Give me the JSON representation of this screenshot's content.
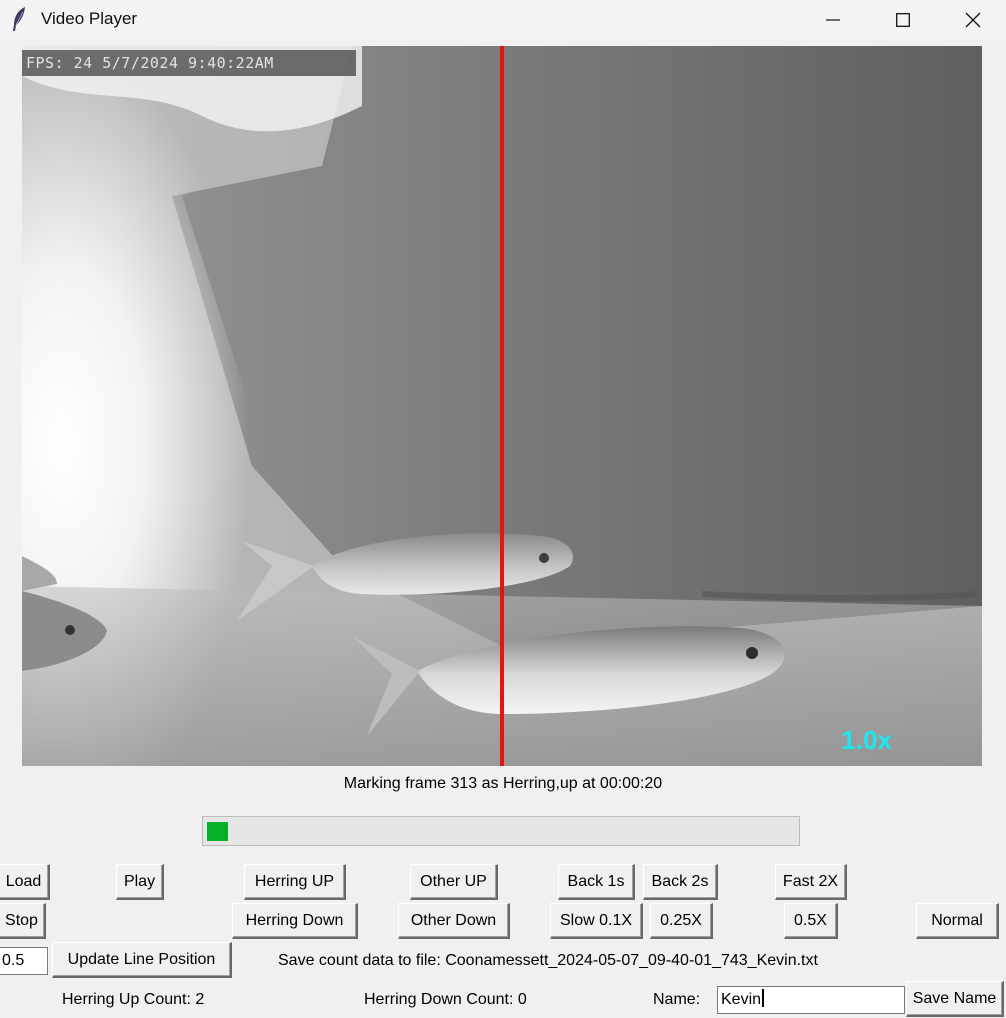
{
  "window": {
    "title": "Video Player",
    "icon": "feather-icon",
    "controls": [
      "minimize-icon",
      "maximize-icon",
      "close-icon"
    ]
  },
  "video": {
    "osd_text": "FPS: 24 5/7/2024 9:40:22AM",
    "speed_overlay": "1.0x",
    "speed_overlay_color": "#19e8f2",
    "count_line_color": "#e81212"
  },
  "status": {
    "message": "Marking frame 313 as Herring,up at 00:00:20"
  },
  "progress": {
    "fraction": 0.035,
    "fill_color": "#06b025"
  },
  "buttons": {
    "load": "Load",
    "play": "Play",
    "herring_up": "Herring UP",
    "other_up": "Other UP",
    "back_1s": "Back 1s",
    "back_2s": "Back 2s",
    "fast_2x": "Fast 2X",
    "stop": "Stop",
    "herring_down": "Herring Down",
    "other_down": "Other Down",
    "slow_01x": "Slow 0.1X",
    "speed_025x": "0.25X",
    "speed_05x": "0.5X",
    "normal": "Normal",
    "update_line": "Update Line Position",
    "save_name": "Save Name"
  },
  "inputs": {
    "line_position": "0.5",
    "name": "Kevin"
  },
  "labels": {
    "save_file": "Save count data to file: Coonamessett_2024-05-07_09-40-01_743_Kevin.txt",
    "herring_up_count": "Herring Up Count: 2",
    "herring_down_count": "Herring Down Count: 0",
    "name": "Name:"
  }
}
